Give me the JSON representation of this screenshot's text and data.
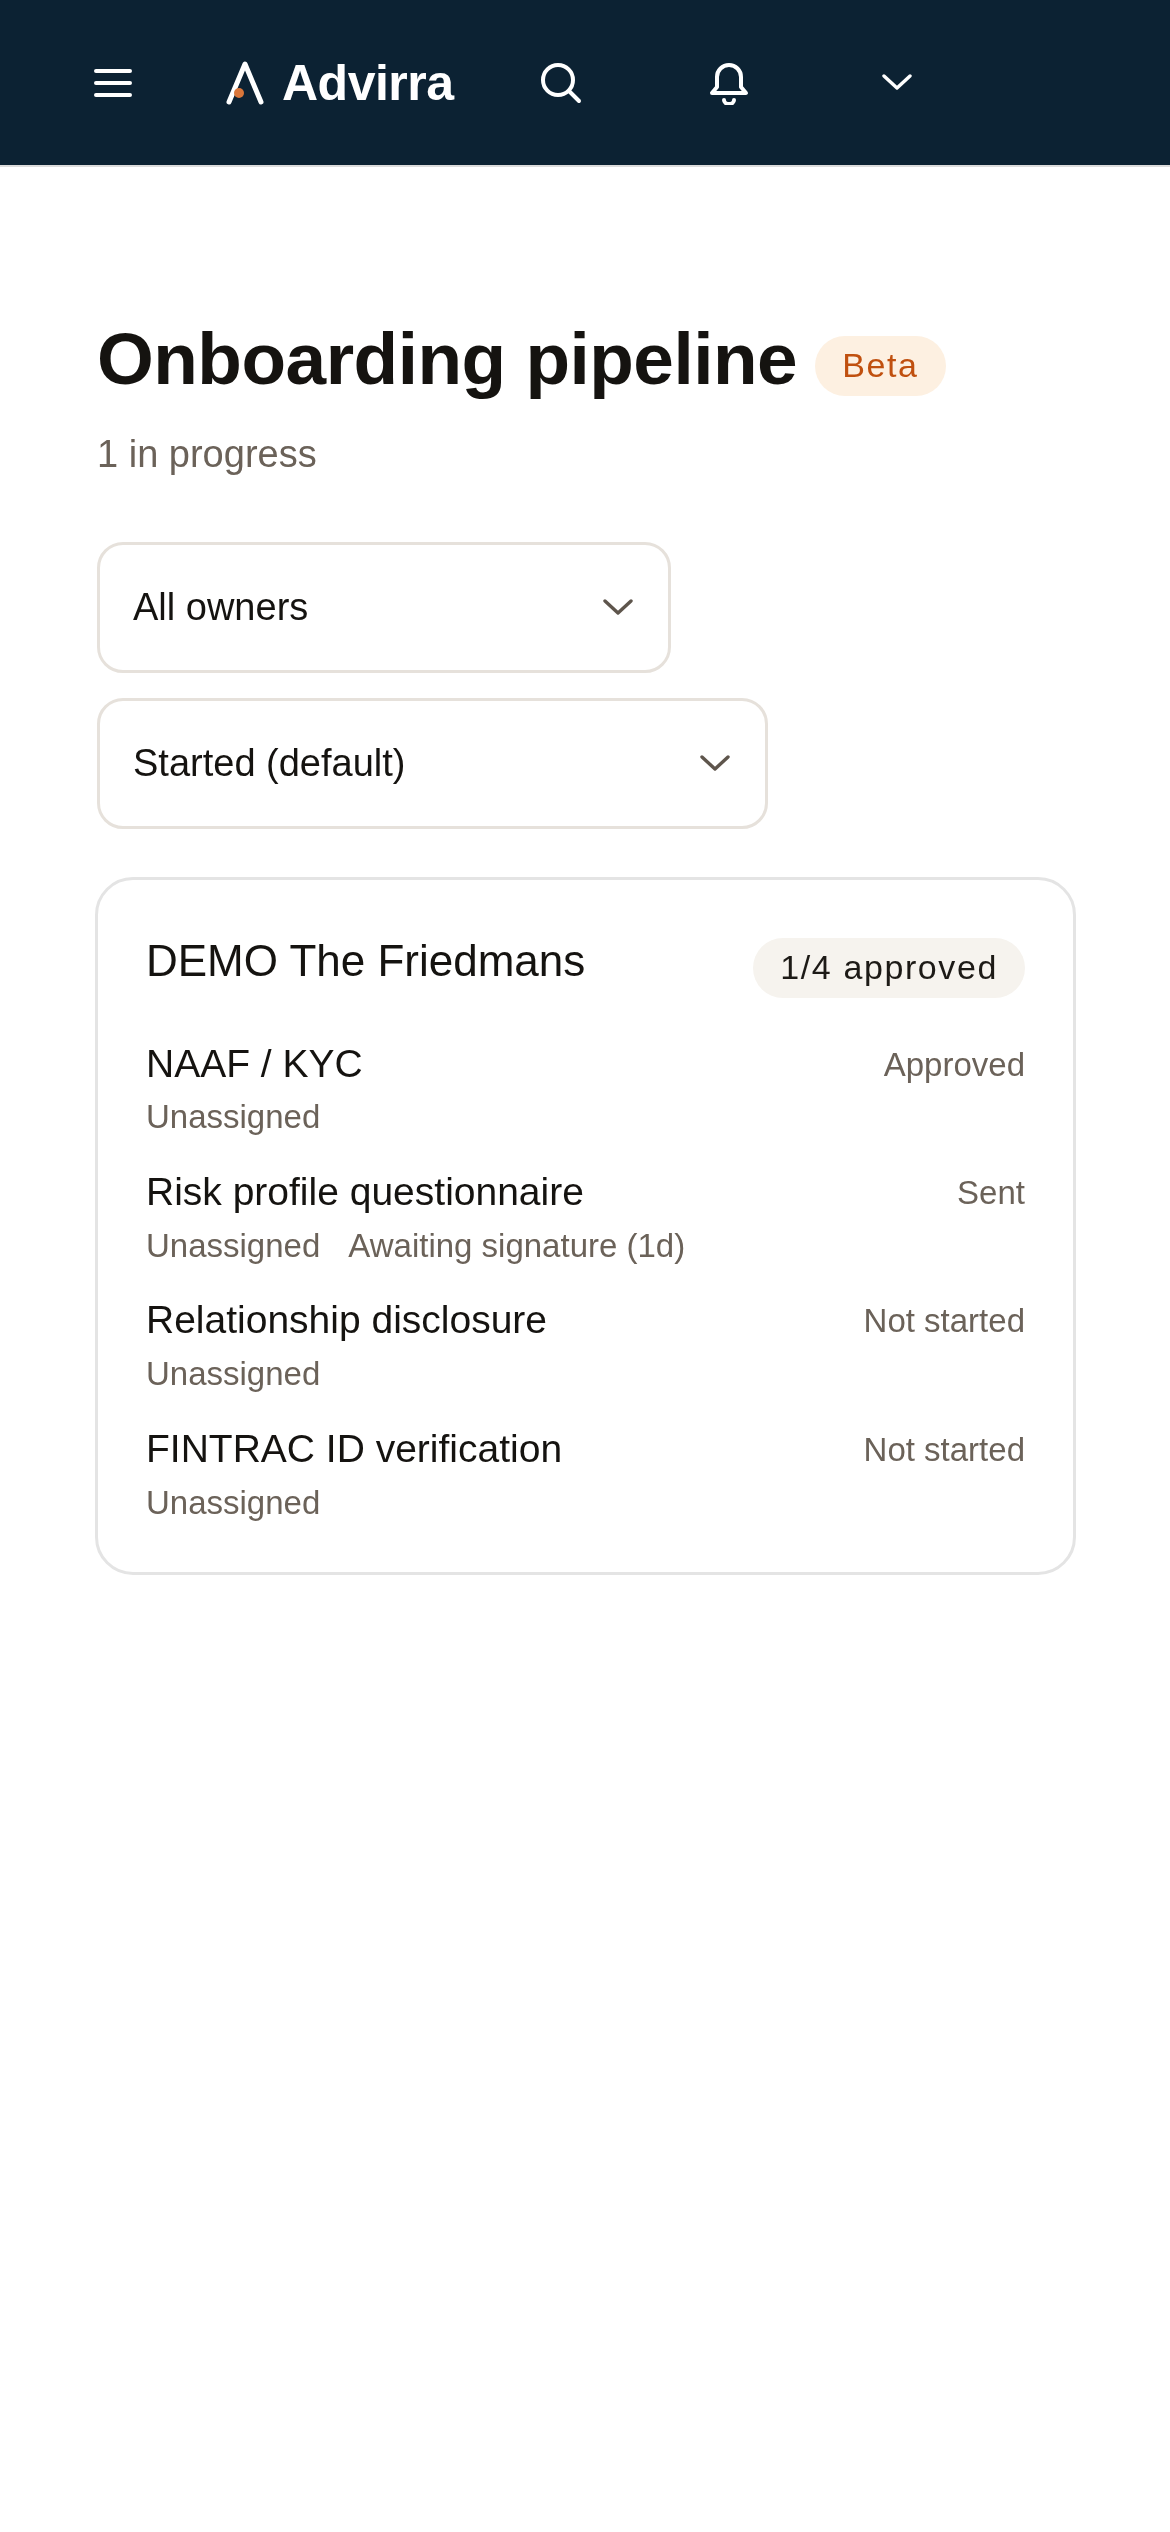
{
  "header": {
    "brand": "Advirra"
  },
  "page": {
    "title": "Onboarding pipeline",
    "badge": "Beta",
    "subtitle": "1 in progress"
  },
  "filters": [
    {
      "value": "All owners"
    },
    {
      "value": "Started (default)"
    }
  ],
  "cards": [
    {
      "title": "DEMO The Friedmans",
      "badge": "1/4 approved",
      "tasks": [
        {
          "name": "NAAF / KYC",
          "assignee": "Unassigned",
          "status": "Approved"
        },
        {
          "name": "Risk profile questionnaire",
          "assignee": "Unassigned",
          "note": "Awaiting signature (1d)",
          "status": "Sent"
        },
        {
          "name": "Relationship disclosure",
          "assignee": "Unassigned",
          "status": "Not started"
        },
        {
          "name": "FINTRAC ID verification",
          "assignee": "Unassigned",
          "status": "Not started"
        }
      ]
    }
  ]
}
